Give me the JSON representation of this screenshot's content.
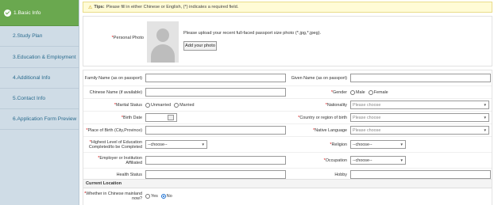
{
  "sidebar": {
    "items": [
      {
        "label": "1.Basic Info",
        "active": true
      },
      {
        "label": "2.Study Plan"
      },
      {
        "label": "3.Education & Employment"
      },
      {
        "label": "4.Additional Info"
      },
      {
        "label": "5.Contact Info"
      },
      {
        "label": "6.Application Form Preview"
      }
    ]
  },
  "tip": {
    "bold": "Tips:",
    "text": "Please fill in either Chinese or English, (*) indicates a required field."
  },
  "photo": {
    "label": "Personal Photo",
    "hint": "Please upload your recent full-faced passport size photo (*.jpg,*.jpeg).",
    "button": "Add your photo"
  },
  "fields": {
    "family_name": "Family Name (as on passport)",
    "given_name": "Given Name (as on passport)",
    "chinese_name": "Chinese Name (if available)",
    "gender": "Gender",
    "gender_male": "Male",
    "gender_female": "Female",
    "marital": "Marital Status",
    "unmarried": "Unmarried",
    "married": "Married",
    "nationality": "Nationality",
    "nationality_ph": "Please choose",
    "birth_date": "Birth Date",
    "country_birth": "Country or region of birth",
    "country_birth_ph": "Please choose",
    "place_birth": "Place of Birth (City,Province)",
    "native_lang": "Native Language",
    "native_lang_ph": "Please choose",
    "education": "Highest Level of Education Completed/to be Completed",
    "education_ph": "--choose--",
    "religion": "Religion",
    "religion_ph": "--choose--",
    "employer": "Employer or Institution Affiliated",
    "occupation": "Occupation",
    "occupation_ph": "--choose--",
    "health": "Health Status",
    "hobby": "Hobby"
  },
  "location": {
    "title": "Current Location",
    "question": "Whether in Chinese mainland now?",
    "yes": "Yes",
    "no": "No",
    "selected": "No"
  }
}
